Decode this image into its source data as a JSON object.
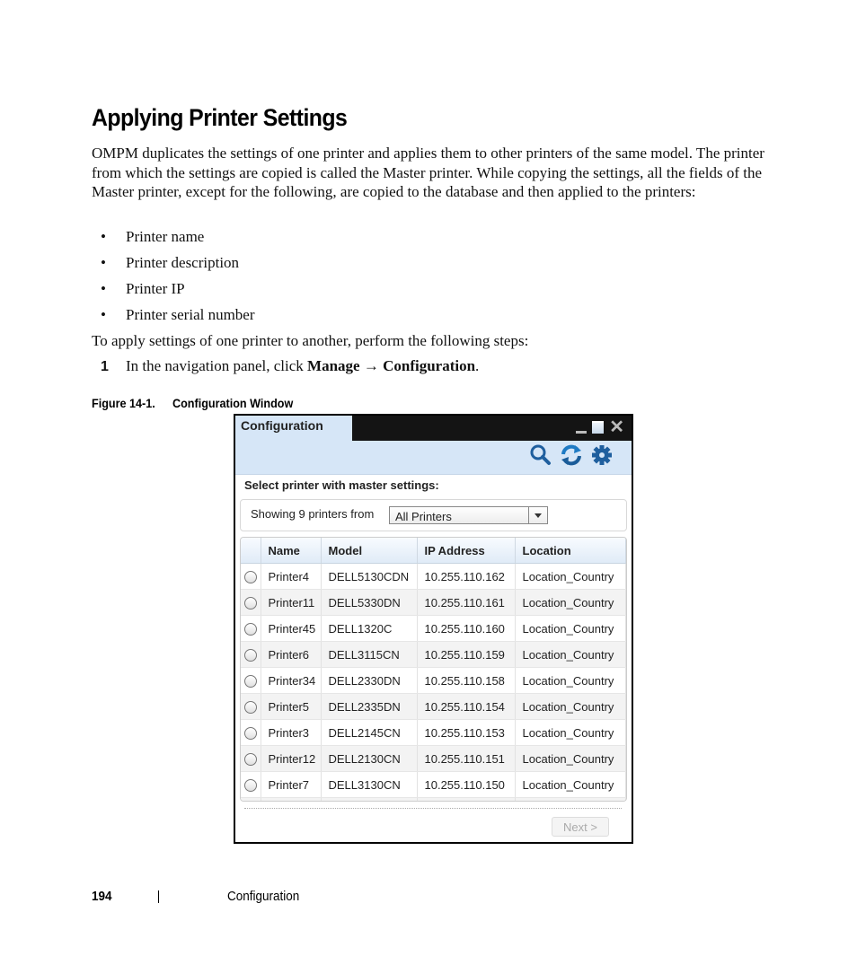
{
  "page": {
    "heading": "Applying Printer Settings",
    "intro": "OMPM duplicates the settings of one printer and applies them to other printers of the same model. The printer from which the settings are copied is called the Master printer. While copying the settings, all the fields of the Master printer, except for the following, are copied to the database and then applied to the printers:",
    "bullet_glyph": "•",
    "bullets": [
      "Printer name",
      "Printer description",
      "Printer IP",
      "Printer serial number"
    ],
    "steps_intro": "To apply settings of one printer to another, perform the following steps:",
    "step1": {
      "number": "1",
      "text_before": "In the navigation panel, click ",
      "menu_path": "Manage → Configuration",
      "text_after": "."
    },
    "figure_caption": {
      "number": "Figure 14-1.",
      "title": "Configuration Window"
    },
    "footer": {
      "page_number": "194",
      "section": "Configuration"
    }
  },
  "window": {
    "title": "Configuration",
    "controls": {
      "minimize": "minimize",
      "maximize": "maximize",
      "close": "✕"
    },
    "toolbar_icons": [
      "search-icon",
      "refresh-icon",
      "gear-icon"
    ],
    "section_label": "Select printer with master settings:",
    "filter": {
      "label": "Showing 9 printers from",
      "selected": "All Printers"
    },
    "table": {
      "columns": [
        "",
        "Name",
        "Model",
        "IP Address",
        "Location"
      ],
      "rows": [
        {
          "name": "Printer4",
          "model": "DELL5130CDN",
          "ip": "10.255.110.162",
          "location": "Location_Country"
        },
        {
          "name": "Printer11",
          "model": "DELL5330DN",
          "ip": "10.255.110.161",
          "location": "Location_Country"
        },
        {
          "name": "Printer45",
          "model": "DELL1320C",
          "ip": "10.255.110.160",
          "location": "Location_Country"
        },
        {
          "name": "Printer6",
          "model": "DELL3115CN",
          "ip": "10.255.110.159",
          "location": "Location_Country"
        },
        {
          "name": "Printer34",
          "model": "DELL2330DN",
          "ip": "10.255.110.158",
          "location": "Location_Country"
        },
        {
          "name": "Printer5",
          "model": "DELL2335DN",
          "ip": "10.255.110.154",
          "location": "Location_Country"
        },
        {
          "name": "Printer3",
          "model": "DELL2145CN",
          "ip": "10.255.110.153",
          "location": "Location_Country"
        },
        {
          "name": "Printer12",
          "model": "DELL2130CN",
          "ip": "10.255.110.151",
          "location": "Location_Country"
        },
        {
          "name": "Printer7",
          "model": "DELL3130CN",
          "ip": "10.255.110.150",
          "location": "Location_Country"
        }
      ]
    },
    "next_button": "Next >",
    "colors": {
      "tab_bg": "#d6e6f7",
      "titlebar_bg": "#141414",
      "icon_blue": "#1f5f9e"
    }
  }
}
